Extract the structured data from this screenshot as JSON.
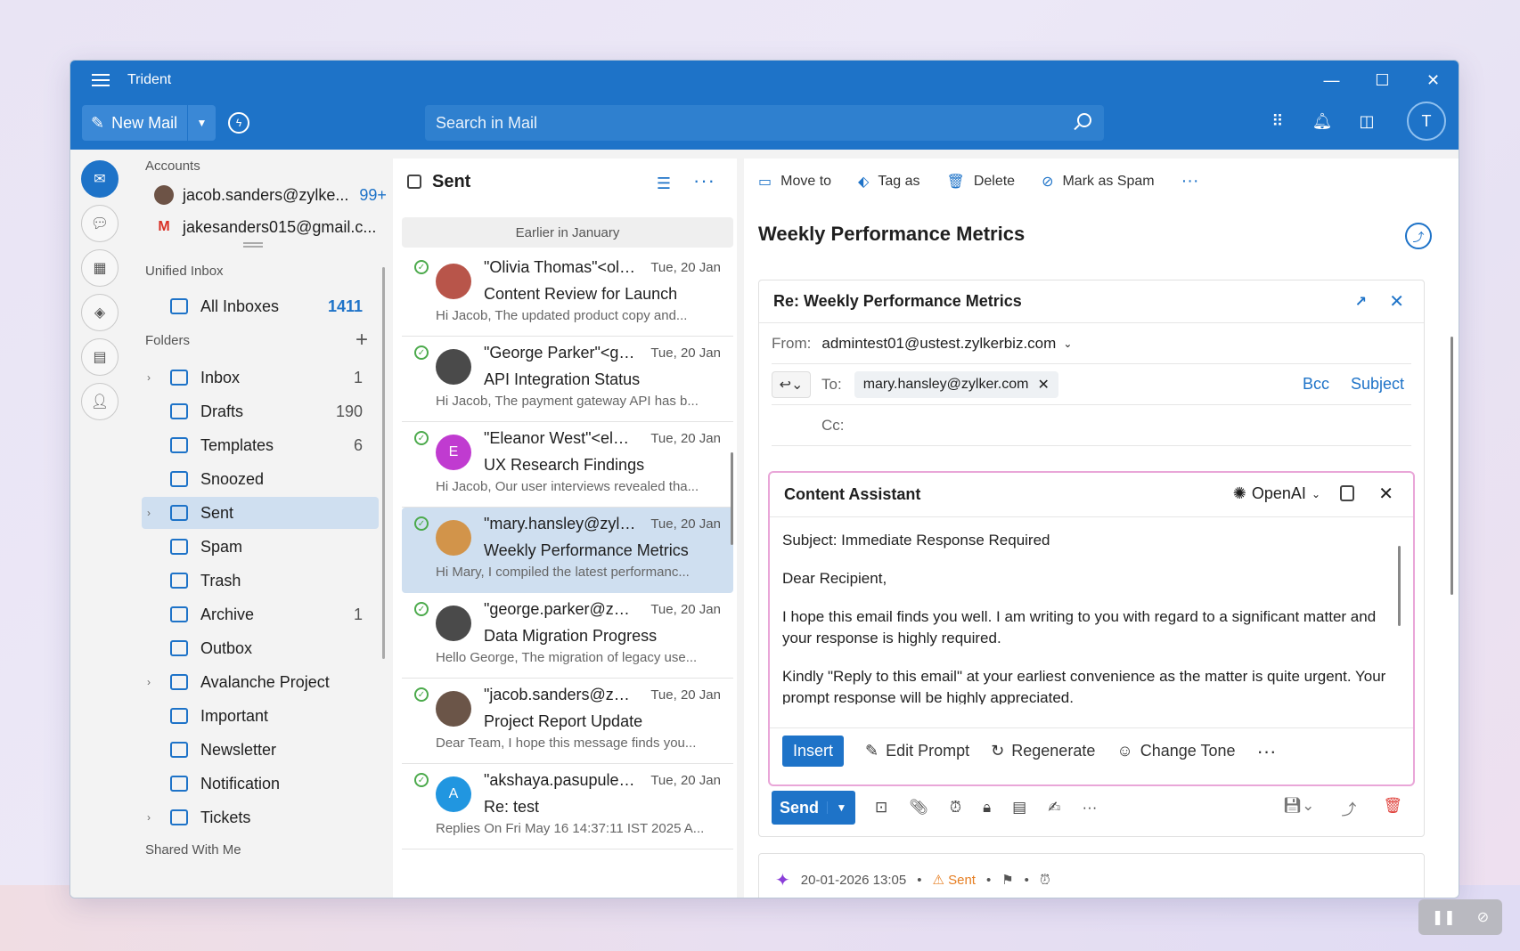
{
  "app": {
    "title": "Trident"
  },
  "toolbar": {
    "new_mail": "New Mail",
    "search_placeholder": "Search in Mail",
    "avatar_initial": "T"
  },
  "accounts": {
    "label": "Accounts",
    "items": [
      {
        "email": "jacob.sanders@zylke...",
        "count": "99+"
      },
      {
        "email": "jakesanders015@gmail.c..."
      }
    ]
  },
  "unified": {
    "label": "Unified Inbox",
    "all_inboxes": "All Inboxes",
    "all_count": "1411"
  },
  "folders": {
    "label": "Folders",
    "items": [
      {
        "name": "Inbox",
        "count": "1",
        "chev": "›"
      },
      {
        "name": "Drafts",
        "count": "190"
      },
      {
        "name": "Templates",
        "count": "6"
      },
      {
        "name": "Snoozed"
      },
      {
        "name": "Sent",
        "chev": "›"
      },
      {
        "name": "Spam"
      },
      {
        "name": "Trash"
      },
      {
        "name": "Archive",
        "count": "1"
      },
      {
        "name": "Outbox"
      },
      {
        "name": "Avalanche Project",
        "chev": "›"
      },
      {
        "name": "Important"
      },
      {
        "name": "Newsletter"
      },
      {
        "name": "Notification"
      },
      {
        "name": "Tickets",
        "chev": "›"
      }
    ],
    "shared_label": "Shared With Me"
  },
  "mail_list": {
    "title": "Sent",
    "group": "Earlier in January",
    "mails": [
      {
        "from": "\"Olivia Thomas\"<olivi...",
        "date": "Tue, 20 Jan",
        "subject": "Content Review for Launch",
        "preview": "Hi Jacob, The updated product copy and...",
        "initial": ""
      },
      {
        "from": "\"George Parker\"<geo...",
        "date": "Tue, 20 Jan",
        "subject": "API Integration Status",
        "preview": "Hi Jacob, The payment gateway API has b...",
        "initial": ""
      },
      {
        "from": "\"Eleanor West\"<elean...",
        "date": "Tue, 20 Jan",
        "subject": "UX Research Findings",
        "preview": "Hi Jacob, Our user interviews revealed tha...",
        "initial": "E"
      },
      {
        "from": "\"mary.hansley@zylke...",
        "date": "Tue, 20 Jan",
        "subject": "Weekly Performance Metrics",
        "preview": "Hi Mary, I compiled the latest performanc...",
        "initial": ""
      },
      {
        "from": "\"george.parker@zylk...",
        "date": "Tue, 20 Jan",
        "subject": "Data Migration Progress",
        "preview": "Hello George, The migration of legacy use...",
        "initial": ""
      },
      {
        "from": "\"jacob.sanders@zylke...",
        "date": "Tue, 20 Jan",
        "subject": "Project Report Update",
        "preview": "Dear Team, I hope this message finds you...",
        "initial": ""
      },
      {
        "from": "\"akshaya.pasupuleti...",
        "date": "Tue, 20 Jan",
        "subject": "Re: test",
        "preview": "Replies On Fri May 16 14:37:11 IST 2025 A...",
        "initial": "A"
      }
    ]
  },
  "reader": {
    "actions": {
      "move": "Move to",
      "tag": "Tag as",
      "delete": "Delete",
      "spam": "Mark as Spam"
    },
    "title": "Weekly Performance Metrics",
    "compose": {
      "subject": "Re: Weekly Performance Metrics",
      "from_label": "From:",
      "from_value": "admintest01@ustest.zylkerbiz.com",
      "to_label": "To:",
      "to_value": "mary.hansley@zylker.com",
      "bcc": "Bcc",
      "subject_link": "Subject",
      "cc_label": "Cc:"
    },
    "assistant": {
      "title": "Content Assistant",
      "provider": "OpenAI",
      "body": [
        "Subject: Immediate Response Required",
        "Dear Recipient,",
        "I hope this email finds you well. I am writing to you with regard to a significant matter and your response is highly required.",
        "Kindly \"Reply to this email\" at your earliest convenience as the matter is quite urgent. Your prompt response will be highly appreciated."
      ],
      "insert": "Insert",
      "edit_prompt": "Edit Prompt",
      "regenerate": "Regenerate",
      "change_tone": "Change Tone"
    },
    "send": "Send",
    "meta": {
      "datetime": "20-01-2026 13:05",
      "status": "Sent"
    }
  }
}
